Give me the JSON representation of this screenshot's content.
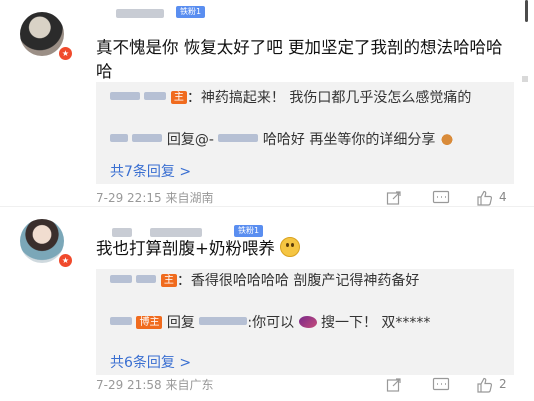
{
  "comments": [
    {
      "badge": "铁粉1",
      "text": "真不愧是你 恢复太好了吧 更加坚定了我剖的想法哈哈哈哈",
      "reply1_label": "主",
      "reply1_text": "：神药搞起来！ 我伤口都几乎没怎么感觉痛的",
      "reply2_prefix": "回复@-",
      "reply2_text": "哈哈好 再坐等你的详细分享",
      "more_replies": "共7条回复 >",
      "time": "7-29 22:15",
      "location": "来自湖南",
      "likes": "4"
    },
    {
      "badge": "铁粉1",
      "text": "我也打算剖腹+奶粉喂养",
      "reply1_label": "主",
      "reply1_text": "：香得很哈哈哈哈 剖腹产记得神药备好",
      "reply2_tag": "博主",
      "reply2_prefix": "回复",
      "reply2_text": ":你可以",
      "reply2_suffix": "搜一下！ 双*****",
      "more_replies": "共6条回复 >",
      "time": "7-29 21:58",
      "location": "来自广东",
      "likes": "2"
    }
  ],
  "icons": {
    "share": "share-icon",
    "comment": "comment-icon",
    "like": "like-icon"
  },
  "colors": {
    "link": "#3a6fd1",
    "poster_tag": "#f06b1e",
    "fan_tag": "#5a8ef0",
    "vip_dot": "#f04a2c"
  }
}
